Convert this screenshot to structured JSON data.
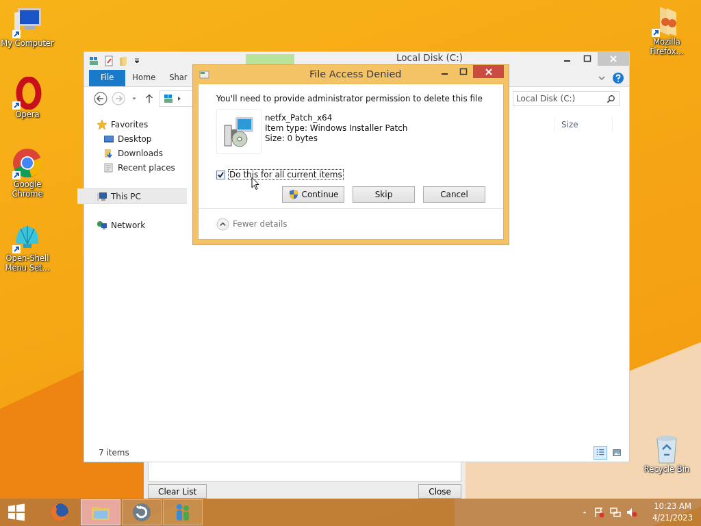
{
  "desktop_icons": [
    {
      "label": "My Computer",
      "kind": "computer"
    },
    {
      "label": "Opera",
      "kind": "opera"
    },
    {
      "label": "Google Chrome",
      "kind": "chrome"
    },
    {
      "label": "Open-Shell Menu Set...",
      "kind": "shell"
    },
    {
      "label": "Mozilla Firefox...",
      "kind": "folder"
    },
    {
      "label": "Recycle Bin",
      "kind": "recycle"
    }
  ],
  "back_window": {
    "buttons": [
      "Clear List",
      "Close"
    ]
  },
  "explorer": {
    "title": "Local Disk (C:)",
    "ribbon_tabs": [
      {
        "label": "File",
        "selected": true
      },
      {
        "label": "Home",
        "selected": false
      },
      {
        "label": "Shar",
        "selected": false
      }
    ],
    "search": {
      "placeholder": "Local Disk (C:)"
    },
    "columns": [
      "Size"
    ],
    "sidebar": [
      {
        "label": "Favorites",
        "kind": "star",
        "selected": false,
        "children": [
          {
            "label": "Desktop",
            "kind": "desktop",
            "selected": false
          },
          {
            "label": "Downloads",
            "kind": "downloads",
            "selected": false
          },
          {
            "label": "Recent places",
            "kind": "recent",
            "selected": false
          }
        ]
      },
      {
        "label": "This PC",
        "kind": "pc",
        "selected": true
      },
      {
        "label": "Network",
        "kind": "network",
        "selected": false
      }
    ],
    "status": "7 items",
    "views": [
      {
        "kind": "details",
        "selected": true
      },
      {
        "kind": "large",
        "selected": false
      }
    ]
  },
  "dialog": {
    "title": "File Access Denied",
    "message": "You'll need to provide administrator permission to delete this file",
    "file": {
      "name": "netfx_Patch_x64",
      "type": "Item type: Windows Installer Patch",
      "size": "Size: 0 bytes"
    },
    "checkbox": {
      "label": "Do this for all current items",
      "checked": true
    },
    "buttons": [
      {
        "label": "Continue",
        "kind": "shield"
      },
      {
        "label": "Skip",
        "kind": "plain"
      },
      {
        "label": "Cancel",
        "kind": "plain"
      }
    ],
    "details_toggle": "Fewer details"
  },
  "taskbar": {
    "apps": [
      {
        "kind": "firefox",
        "selected": false
      },
      {
        "kind": "explorer",
        "selected": true
      },
      {
        "kind": "update",
        "selected": false
      },
      {
        "kind": "people",
        "selected": false
      }
    ],
    "time": "10:23 AM",
    "date": "4/21/2023"
  }
}
